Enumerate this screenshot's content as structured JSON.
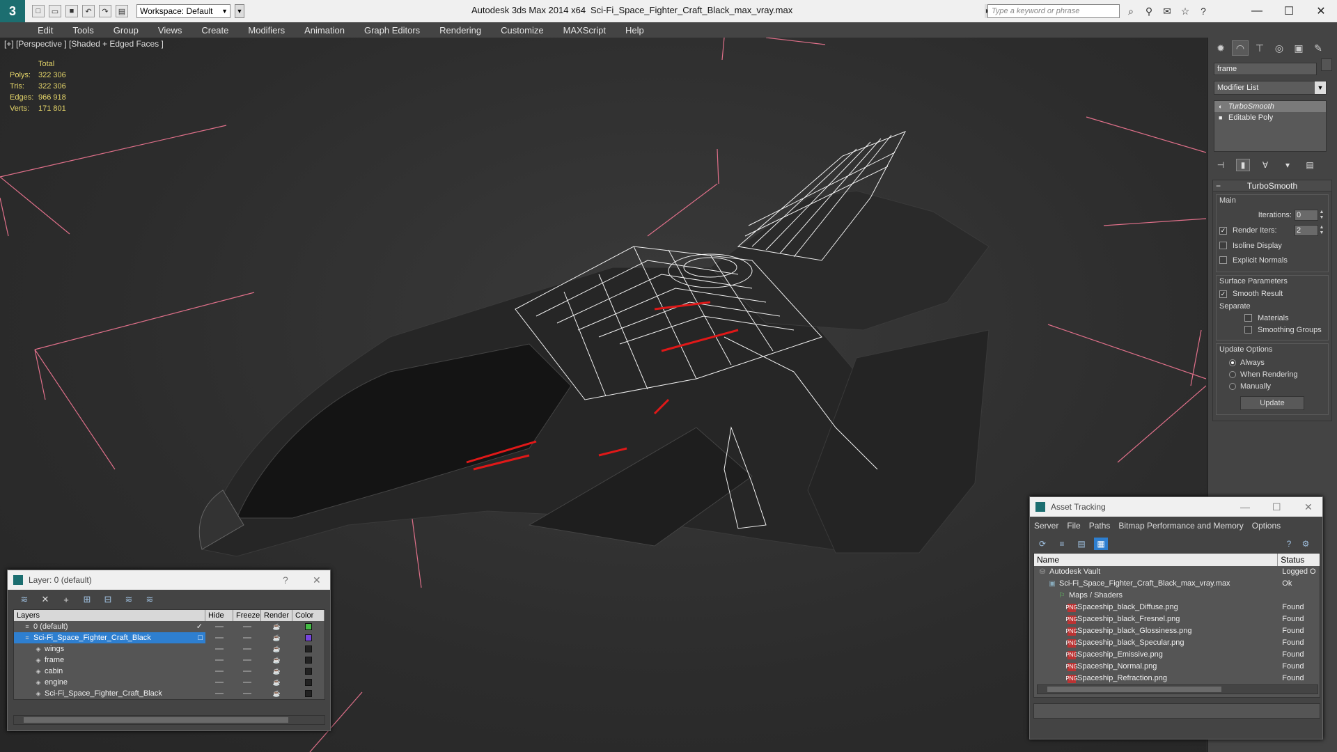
{
  "title_bar": {
    "workspace": "Workspace: Default",
    "app_name": "Autodesk 3ds Max  2014 x64",
    "file_name": "Sci-Fi_Space_Fighter_Craft_Black_max_vray.max",
    "search_placeholder": "Type a keyword or phrase"
  },
  "menu": [
    "Edit",
    "Tools",
    "Group",
    "Views",
    "Create",
    "Modifiers",
    "Animation",
    "Graph Editors",
    "Rendering",
    "Customize",
    "MAXScript",
    "Help"
  ],
  "viewport": {
    "label": "[+] [Perspective ] [Shaded + Edged Faces ]",
    "stats": {
      "header": "Total",
      "rows": [
        {
          "k": "Polys:",
          "v": "322 306"
        },
        {
          "k": "Tris:",
          "v": "322 306"
        },
        {
          "k": "Edges:",
          "v": "966 918"
        },
        {
          "k": "Verts:",
          "v": "171 801"
        }
      ]
    }
  },
  "command_panel": {
    "object_name": "frame",
    "modifier_list": "Modifier List",
    "stack": [
      "TurboSmooth",
      "Editable Poly"
    ],
    "rollout_title": "TurboSmooth",
    "main_group": "Main",
    "iterations_label": "Iterations:",
    "iterations_value": "0",
    "render_iters_label": "Render Iters:",
    "render_iters_value": "2",
    "isoline": "Isoline Display",
    "explicit_normals": "Explicit Normals",
    "surface_group": "Surface Parameters",
    "smooth_result": "Smooth Result",
    "separate": "Separate",
    "materials": "Materials",
    "smoothing_groups": "Smoothing Groups",
    "update_group": "Update Options",
    "always": "Always",
    "when_rendering": "When Rendering",
    "manually": "Manually",
    "update_button": "Update"
  },
  "layer_window": {
    "title": "Layer: 0 (default)",
    "help": "?",
    "headers": [
      "Layers",
      "Hide",
      "Freeze",
      "Render",
      "Color"
    ],
    "rows": [
      {
        "name": "0 (default)",
        "indent": 1,
        "color": "#44bb44",
        "selected": false,
        "check": true
      },
      {
        "name": "Sci-Fi_Space_Fighter_Craft_Black",
        "indent": 1,
        "color": "#7744dd",
        "selected": true,
        "check": false
      },
      {
        "name": "wings",
        "indent": 2,
        "color": "#222222",
        "selected": false,
        "check": false
      },
      {
        "name": "frame",
        "indent": 2,
        "color": "#222222",
        "selected": false,
        "check": false
      },
      {
        "name": "cabin",
        "indent": 2,
        "color": "#222222",
        "selected": false,
        "check": false
      },
      {
        "name": "engine",
        "indent": 2,
        "color": "#222222",
        "selected": false,
        "check": false
      },
      {
        "name": "Sci-Fi_Space_Fighter_Craft_Black",
        "indent": 2,
        "color": "#222222",
        "selected": false,
        "check": false
      }
    ]
  },
  "asset_window": {
    "title": "Asset Tracking",
    "menu": [
      "Server",
      "File",
      "Paths",
      "Bitmap Performance and Memory",
      "Options"
    ],
    "headers": [
      "Name",
      "Status"
    ],
    "rows": [
      {
        "name": "Autodesk Vault",
        "status": "Logged O",
        "indent": 1,
        "icon": "vault"
      },
      {
        "name": "Sci-Fi_Space_Fighter_Craft_Black_max_vray.max",
        "status": "Ok",
        "indent": 2,
        "icon": "max"
      },
      {
        "name": "Maps / Shaders",
        "status": "",
        "indent": 3,
        "icon": "folder"
      },
      {
        "name": "Spaceship_black_Diffuse.png",
        "status": "Found",
        "indent": 4,
        "icon": "png"
      },
      {
        "name": "Spaceship_black_Fresnel.png",
        "status": "Found",
        "indent": 4,
        "icon": "png"
      },
      {
        "name": "Spaceship_black_Glossiness.png",
        "status": "Found",
        "indent": 4,
        "icon": "png"
      },
      {
        "name": "Spaceship_black_Specular.png",
        "status": "Found",
        "indent": 4,
        "icon": "png"
      },
      {
        "name": "Spaceship_Emissive.png",
        "status": "Found",
        "indent": 4,
        "icon": "png"
      },
      {
        "name": "Spaceship_Normal.png",
        "status": "Found",
        "indent": 4,
        "icon": "png"
      },
      {
        "name": "Spaceship_Refraction.png",
        "status": "Found",
        "indent": 4,
        "icon": "png"
      }
    ]
  }
}
